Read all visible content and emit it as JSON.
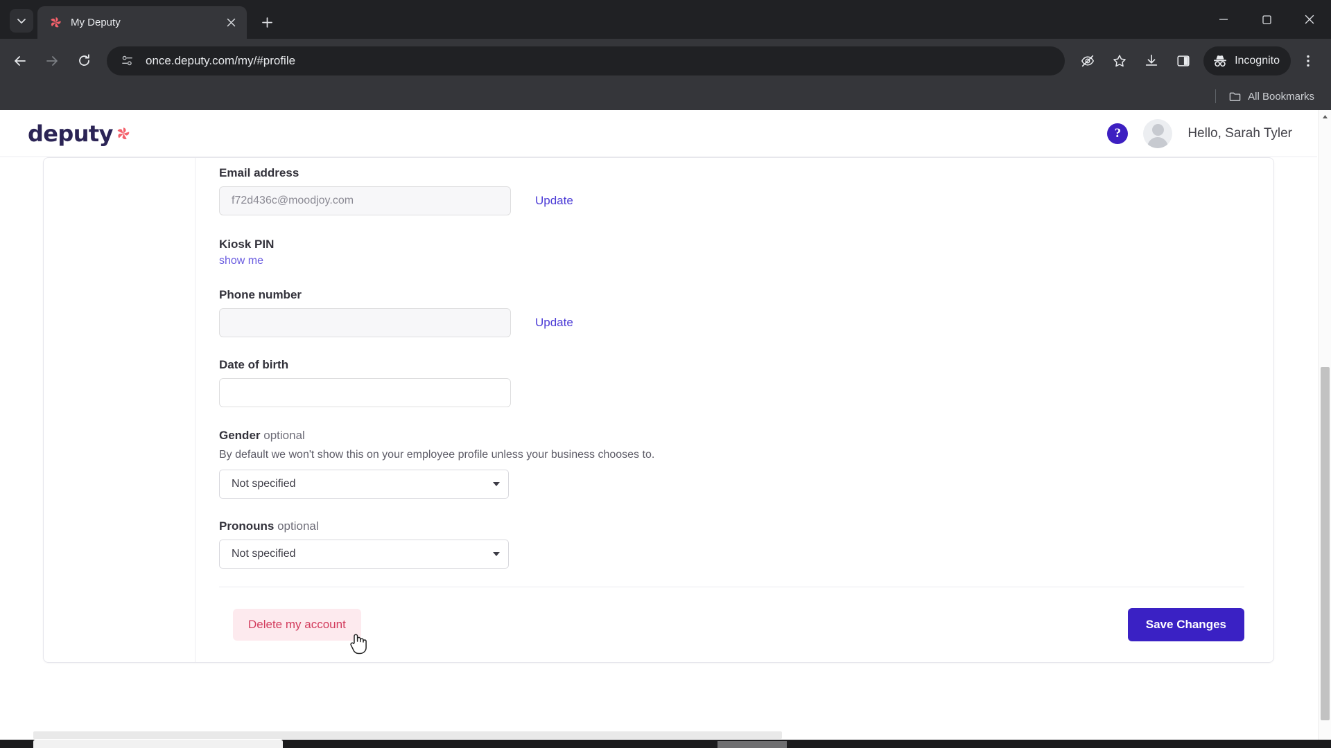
{
  "browser": {
    "tab": {
      "title": "My Deputy",
      "favicon": "deputy-pinwheel-icon"
    },
    "tablist_label": "Search tabs",
    "newtab_label": "New Tab",
    "back_label": "Back",
    "forward_label": "Forward",
    "reload_label": "Reload",
    "url": "once.deputy.com/my/#profile",
    "url_placeholder": "Search Google or type a URL",
    "incognito_label": "Incognito",
    "bookmarks_label": "All Bookmarks",
    "window": {
      "minimize": "–",
      "maximize": "□",
      "close": "✕"
    }
  },
  "app": {
    "logo_text": "deputy",
    "help_label": "?",
    "greeting": "Hello, Sarah Tyler"
  },
  "form": {
    "email": {
      "label": "Email address",
      "value": "f72d436c@moodjoy.com",
      "update_label": "Update"
    },
    "kiosk_pin": {
      "label": "Kiosk PIN",
      "show_label": "show me"
    },
    "phone": {
      "label": "Phone number",
      "value": "",
      "placeholder": "",
      "update_label": "Update"
    },
    "dob": {
      "label": "Date of birth",
      "value": "",
      "placeholder": ""
    },
    "gender": {
      "label": "Gender",
      "optional": "optional",
      "help": "By default we won't show this on your employee profile unless your business chooses to.",
      "selected": "Not specified",
      "options": [
        "Not specified"
      ]
    },
    "pronouns": {
      "label": "Pronouns",
      "optional": "optional",
      "selected": "Not specified",
      "options": [
        "Not specified"
      ]
    }
  },
  "actions": {
    "delete_label": "Delete my account",
    "save_label": "Save Changes"
  },
  "colors": {
    "brand_purple": "#3a21c4",
    "link_purple": "#4b3bd6",
    "delete_red": "#d23b5c",
    "delete_bg": "#fdeaee",
    "logo_navy": "#2b2455",
    "logo_coral": "#f4616b"
  }
}
